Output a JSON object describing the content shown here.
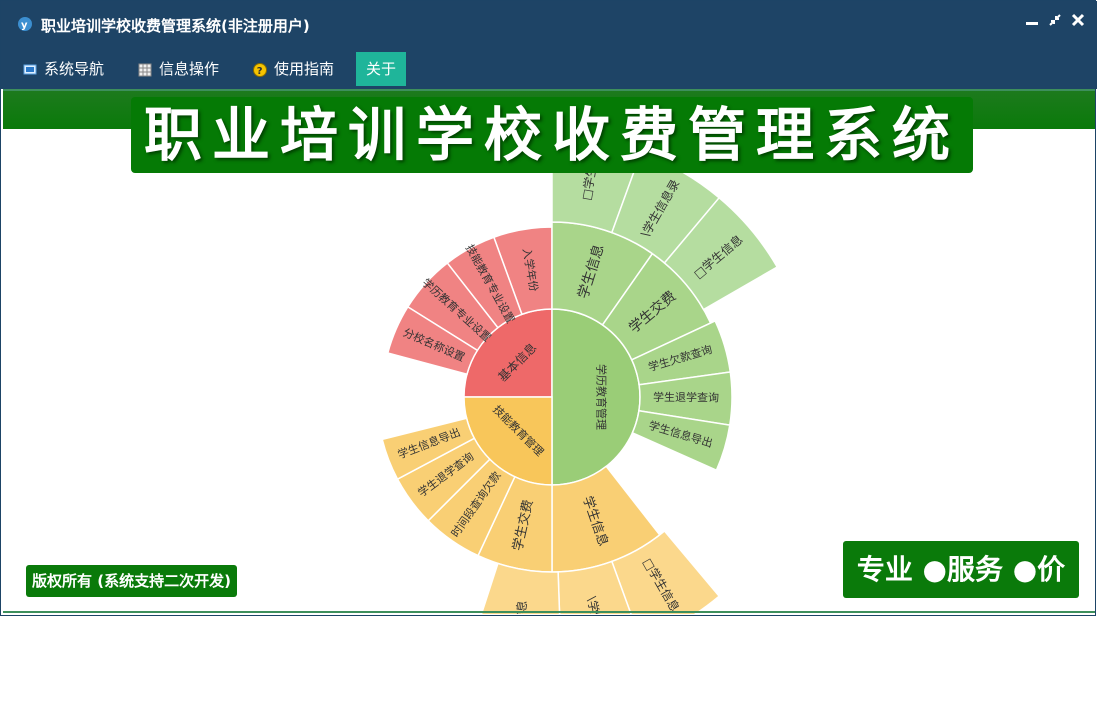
{
  "window": {
    "title": "职业培训学校收费管理系统(非注册用户)",
    "controls": {
      "minimize_icon": "minimize-icon",
      "restore_icon": "restore-icon",
      "close_icon": "close-icon"
    }
  },
  "menu": {
    "items": [
      {
        "label": "系统导航",
        "icon": "monitor-icon"
      },
      {
        "label": "信息操作",
        "icon": "grid-icon"
      },
      {
        "label": "使用指南",
        "icon": "help-icon"
      },
      {
        "label": "关于",
        "icon": ""
      }
    ]
  },
  "banner": {
    "title": "职业培训学校收费管理系统"
  },
  "footer": {
    "copyright": "版权所有 (系统支持二次开发)",
    "slogan": "专业 ●服务 ●价值"
  },
  "colors": {
    "titlebar": "#1e4466",
    "menu_active": "#1fb59a",
    "banner": "#057a05",
    "sunburst_red": "#ec6b6b",
    "sunburst_green": "#9acb78",
    "sunburst_yellow": "#f8c65a"
  },
  "sunburst": {
    "inner": [
      {
        "label": "基本信息",
        "color": "#ee6969"
      },
      {
        "label": "学历教育管理",
        "color": "#9acd77"
      },
      {
        "label": "技能教育管理",
        "color": "#f8c65a"
      }
    ],
    "red_children": [
      "入学年份",
      "技能教育专业设置",
      "学历教育专业设置",
      "分校名称设置"
    ],
    "green_children": [
      "学生信息",
      "学生交费",
      "学生欠款查询",
      "学生退学查询",
      "学生信息导出"
    ],
    "green_outer": [
      "□学生",
      "\\学生信息录",
      "□学生信息"
    ],
    "yellow_children": [
      "学生信息",
      "学生交费",
      "时间段查询欠款",
      "学生退学查询",
      "学生信息导出"
    ],
    "yellow_outer": [
      "□学生信息",
      "\\学生",
      "信息"
    ]
  }
}
